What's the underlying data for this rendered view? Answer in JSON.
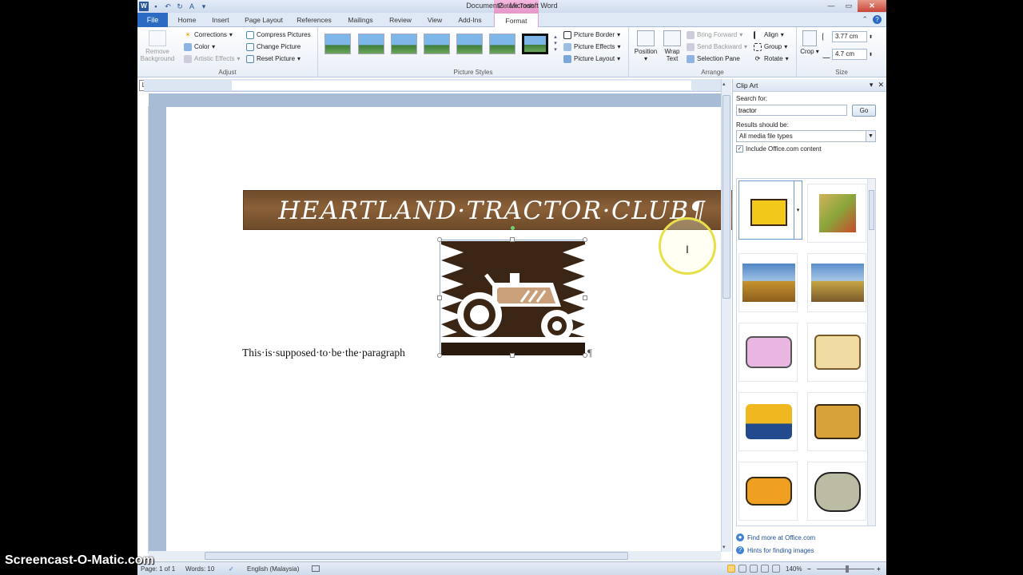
{
  "title_bar": {
    "document_title": "Document2 - Microsoft Word",
    "contextual_tab_group": "Picture Tools",
    "qat_icons": [
      "word-logo",
      "save-icon",
      "undo-icon",
      "redo-icon",
      "format-painter-icon",
      "customize-icon"
    ],
    "window_controls": [
      "minimize",
      "maximize",
      "close"
    ]
  },
  "tabs": {
    "file": "File",
    "items": [
      "Home",
      "Insert",
      "Page Layout",
      "References",
      "Mailings",
      "Review",
      "View",
      "Add-Ins",
      "Format"
    ],
    "active": "Format"
  },
  "ribbon": {
    "adjust": {
      "label": "Adjust",
      "remove_background": "Remove Background",
      "corrections": "Corrections",
      "color": "Color",
      "artistic_effects": "Artistic Effects",
      "compress_pictures": "Compress Pictures",
      "change_picture": "Change Picture",
      "reset_picture": "Reset Picture"
    },
    "picture_styles": {
      "label": "Picture Styles",
      "picture_border": "Picture Border",
      "picture_effects": "Picture Effects",
      "picture_layout": "Picture Layout"
    },
    "arrange": {
      "label": "Arrange",
      "position": "Position",
      "wrap_text": "Wrap Text",
      "bring_forward": "Bring Forward",
      "send_backward": "Send Backward",
      "selection_pane": "Selection Pane",
      "align": "Align",
      "group": "Group",
      "rotate": "Rotate"
    },
    "size": {
      "label": "Size",
      "crop": "Crop",
      "height": "3.77 cm",
      "width": "4.7 cm"
    }
  },
  "document": {
    "banner_text": "HEARTLAND·TRACTOR·CLUB¶",
    "paragraph": "This·is·supposed·to·be·the·paragraph",
    "pilcrow": "¶"
  },
  "clip_art_pane": {
    "title": "Clip Art",
    "search_label": "Search for:",
    "search_value": "tractor",
    "go_button": "Go",
    "results_label": "Results should be:",
    "results_value": "All media file types",
    "include_office": "Include Office.com content",
    "include_checked": true,
    "find_more": "Find more at Office.com",
    "hints": "Hints for finding images",
    "result_items": [
      "tractor-icon-yellow",
      "farm-field-clipart",
      "combine-harvester-photo",
      "excavator-photo",
      "pink-tractor-clipart",
      "cart-with-animals-clipart",
      "blue-yellow-tractor",
      "yellow-tractor-clipart",
      "riding-mower-clipart",
      "tractor-plowing-clipart"
    ]
  },
  "status_bar": {
    "page": "Page: 1 of 1",
    "words": "Words: 10",
    "language": "English (Malaysia)",
    "zoom": "140%"
  },
  "watermark": "Screencast-O-Matic.com",
  "colors": {
    "banner": "#7a5432",
    "file_tab": "#2b6bc2",
    "picture_tools": "#f0a8d8",
    "cursor_highlight": "#e8e04a"
  }
}
